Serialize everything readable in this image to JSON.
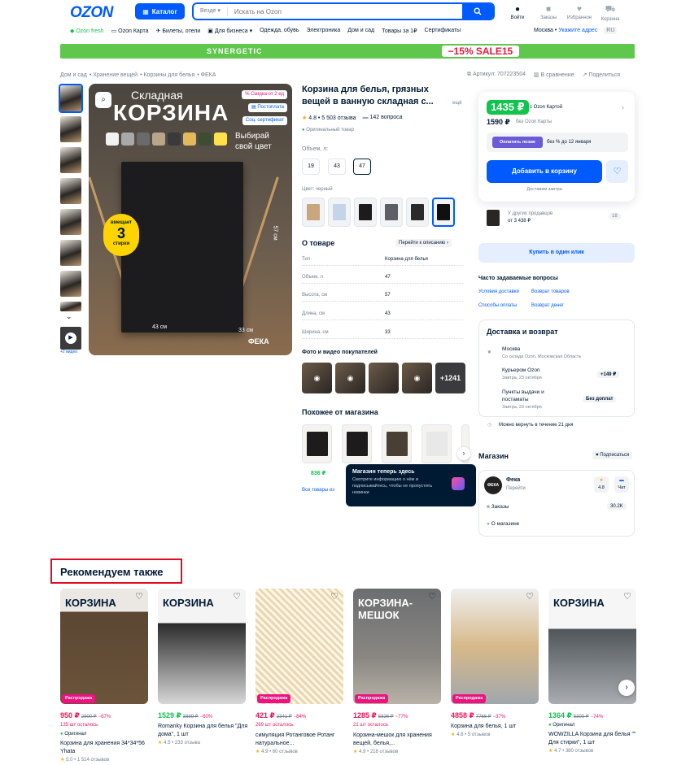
{
  "header": {
    "logo": "OZON",
    "catalog_label": "Каталог",
    "search_scope": "Везде",
    "search_placeholder": "Искать на Ozon",
    "actions": [
      {
        "label": "Войти",
        "icon": "user-icon"
      },
      {
        "label": "Заказы",
        "icon": "box-icon"
      },
      {
        "label": "Избранное",
        "icon": "heart-icon"
      },
      {
        "label": "Корзина",
        "icon": "cart-icon"
      }
    ]
  },
  "subnav": {
    "items": [
      "Ozon fresh",
      "Ozon Карта",
      "Билеты, отели",
      "Для бизнеса",
      "Одежда, обувь",
      "Электроника",
      "Дом и сад",
      "Товары за 1₽",
      "Сертификаты"
    ],
    "city": "Москва",
    "address": "Укажите адрес",
    "lang": "RU"
  },
  "banner": {
    "brand": "SYNERGETIC",
    "promo": "−15%  SALE15"
  },
  "breadcrumb": [
    "Дом и сад",
    "Хранение вещей",
    "Корзины для белья",
    "ФЕКА"
  ],
  "article": {
    "label": "Артикул: 707223504",
    "compare": "В сравнение",
    "share": "Поделиться"
  },
  "gallery": {
    "video_label": "+2 видео",
    "image_title_1": "Складная",
    "image_title_2": "КОРЗИНА",
    "image_slogan": "Выбирай свой цвет",
    "tags": [
      "Скидка от 2 ед",
      "Постоплата",
      "Соц. сертификат"
    ],
    "badge_top": "вмещает",
    "badge_num": "3",
    "badge_bottom": "стирки",
    "dim_1": "43 см",
    "dim_2": "33 см",
    "dim_3": "57 см",
    "brand_mark": "ФЕКА",
    "swatch_colors": [
      "#f2f2f2",
      "#a9a9a9",
      "#6a6a6a",
      "#b9a58a",
      "#3a3a3a",
      "#e6b85c",
      "#3d4d33",
      "#ffe04d"
    ]
  },
  "product": {
    "title": "Корзина для белья, грязных вещей в ванную складная с...",
    "title_more": "ещё",
    "rating": "4.8 • 5 503 отзыва",
    "questions": "142 вопроса",
    "original": "Оригинальный товар",
    "volume_label": "Объем, л:",
    "volumes": [
      "19",
      "43",
      "47"
    ],
    "color_label": "Цвет: черный",
    "colors": [
      "#c9a77c",
      "#c5d4e8",
      "#1d1b1b",
      "#5c5f66",
      "#2a2a2a",
      "#101010"
    ]
  },
  "about": {
    "title": "О товаре",
    "link": "Перейти к описанию",
    "rows": [
      {
        "k": "Тип",
        "v": "Корзина для белья"
      },
      {
        "k": "Объем, л",
        "v": "47"
      },
      {
        "k": "Высота, см",
        "v": "57"
      },
      {
        "k": "Длина, см",
        "v": "43"
      },
      {
        "k": "Ширина, см",
        "v": "33"
      }
    ]
  },
  "photos": {
    "title": "Фото и видео покупателей",
    "more": "+1241"
  },
  "similar": {
    "title": "Похожее от магазина",
    "price": "836 ₽",
    "all": "Все товары из"
  },
  "price": {
    "main": "1435 ₽",
    "main_note": "с Ozon Картой",
    "alt": "1590 ₽",
    "alt_note": "без Ozon Карты",
    "pay_btn": "Оплатить позже",
    "pay_note": "без % до 12 января",
    "cart_btn": "Добавить в корзину",
    "delivery_note": "Доставим завтра",
    "other_sellers_1": "У других продавцов",
    "other_sellers_2": "от 3 438 ₽",
    "other_sellers_count": "18",
    "one_click": "Купить в один клик"
  },
  "faq": {
    "title": "Часто задаваемые вопросы",
    "links": [
      "Условия доставки",
      "Возврат товаров",
      "Способы оплаты",
      "Возврат денег"
    ]
  },
  "delivery": {
    "title": "Доставка и возврат",
    "city": "Москва",
    "city_sub": "Со склада Ozon, Московская Область",
    "courier": "Курьером Ozon",
    "courier_sub": "Завтра, 23 октября",
    "courier_price": "+149 ₽",
    "pickup_1": "Пункты выдачи и",
    "pickup_2": "постаматы",
    "pickup_sub": "Завтра, 23 октября",
    "pickup_price": "Без доплат",
    "return": "Можно вернуть в течение 21 дня"
  },
  "shop": {
    "title": "Магазин",
    "subscribe": "Подписаться",
    "logo": "ФЕКА",
    "name": "Фека",
    "go": "Перейти",
    "rating": "4.8",
    "chat": "Чат",
    "orders": "Заказы",
    "orders_count": "30.2K",
    "about": "О магазине"
  },
  "tooltip": {
    "title": "Магазин теперь здесь",
    "text": "Смотрите информацию о нём и подписывайтесь, чтобы не пропустить новинки"
  },
  "recommend": {
    "title": "Рекомендуем также",
    "items": [
      {
        "price": "950 ₽",
        "old": "2900 ₽",
        "pct": "−67%",
        "left": "135 шт осталось",
        "orig": "Оригинал",
        "name": "Корзина для хранения 34*34*56 Yhata",
        "rating": "5.0",
        "reviews": "1 514 отзывов",
        "badge": "Распродажа",
        "green": false,
        "img_title": "КОРЗИНА"
      },
      {
        "price": "1529 ₽",
        "old": "3899 ₽",
        "pct": "−60%",
        "left": "",
        "orig": "",
        "name": "Romanky Корзина для белья \"Для дома\", 1 шт",
        "rating": "4.5",
        "reviews": "233 отзыва",
        "badge": "",
        "green": true,
        "img_title": "КОРЗИНА"
      },
      {
        "price": "421 ₽",
        "old": "2341 ₽",
        "pct": "−84%",
        "left": "269 шт осталось",
        "orig": "",
        "name": "симуляция Ротанговое Ротанг натуральное...",
        "rating": "4.9",
        "reviews": "60 отзывов",
        "badge": "Распродажа",
        "green": false,
        "img_title": ""
      },
      {
        "price": "1285 ₽",
        "old": "5826 ₽",
        "pct": "−77%",
        "left": "21 шт осталось",
        "orig": "",
        "name": "Корзина-мешок для хранения вещей, белья,...",
        "rating": "4.9",
        "reviews": "218 отзывов",
        "badge": "Распродажа",
        "green": false,
        "img_title": "КОРЗИНА-МЕШОК"
      },
      {
        "price": "4858 ₽",
        "old": "7766 ₽",
        "pct": "−37%",
        "left": "",
        "orig": "",
        "name": "Корзина для белья, 1 шт",
        "rating": "4.8",
        "reviews": "5 отзывов",
        "badge": "Распродажа",
        "green": false,
        "img_title": ""
      },
      {
        "price": "1364 ₽",
        "old": "5300 ₽",
        "pct": "−74%",
        "left": "",
        "orig": "Оригинал",
        "name": "WOWZILLA Корзина для белья \"\" Для стирки\", 1 шт",
        "rating": "4.7",
        "reviews": "380 отзывов",
        "badge": "",
        "green": true,
        "img_title": "КОРЗИНА"
      }
    ]
  }
}
